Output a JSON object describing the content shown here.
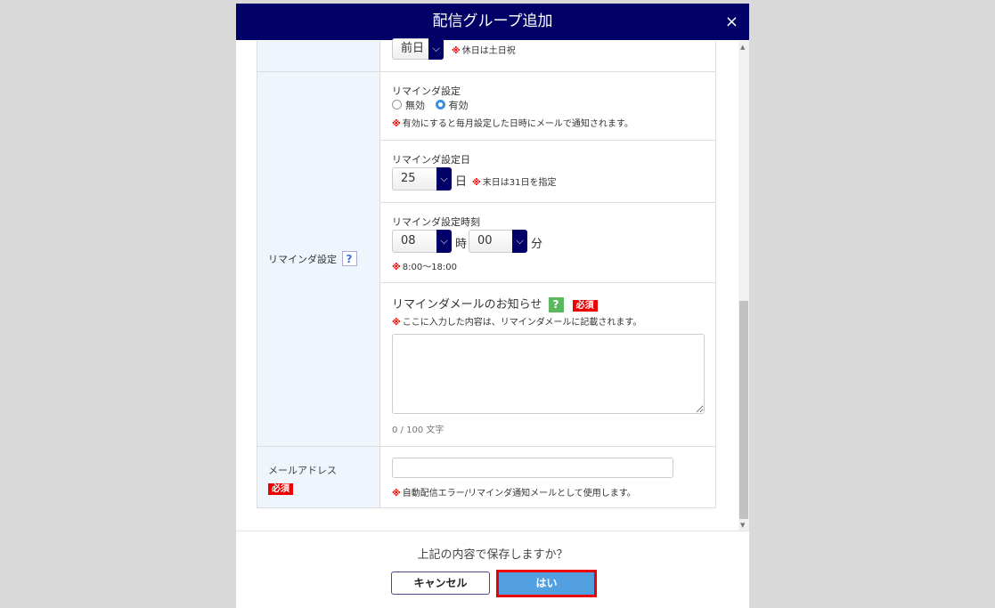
{
  "dialog": {
    "title": "配信グループ追加",
    "close_label": "×"
  },
  "holiday_row": {
    "select_value": "前日",
    "note": "休日は土日祝"
  },
  "reminder": {
    "label": "リマインダ設定",
    "help": "?",
    "setting": {
      "title": "リマインダ設定",
      "options": [
        "無効",
        "有効"
      ],
      "selected": "有効",
      "note": "有効にすると毎月設定した日時にメールで通知されます。"
    },
    "day": {
      "title": "リマインダ設定日",
      "value": "25",
      "unit": "日",
      "note": "末日は31日を指定"
    },
    "time": {
      "title": "リマインダ設定時刻",
      "hour": "08",
      "hour_unit": "時",
      "minute": "00",
      "minute_unit": "分",
      "note": "8:00〜18:00"
    },
    "message": {
      "title": "リマインダメールのお知らせ",
      "help": "?",
      "required": "必須",
      "note": "ここに入力した内容は、リマインダメールに記載されます。",
      "value": "",
      "counter": "0 / 100 文字"
    }
  },
  "email": {
    "label": "メールアドレス",
    "required": "必須",
    "value": "",
    "note": "自動配信エラー/リマインダ通知メールとして使用します。"
  },
  "footer": {
    "question": "上記の内容で保存しますか？",
    "cancel": "キャンセル",
    "ok": "はい"
  },
  "mark": "※"
}
